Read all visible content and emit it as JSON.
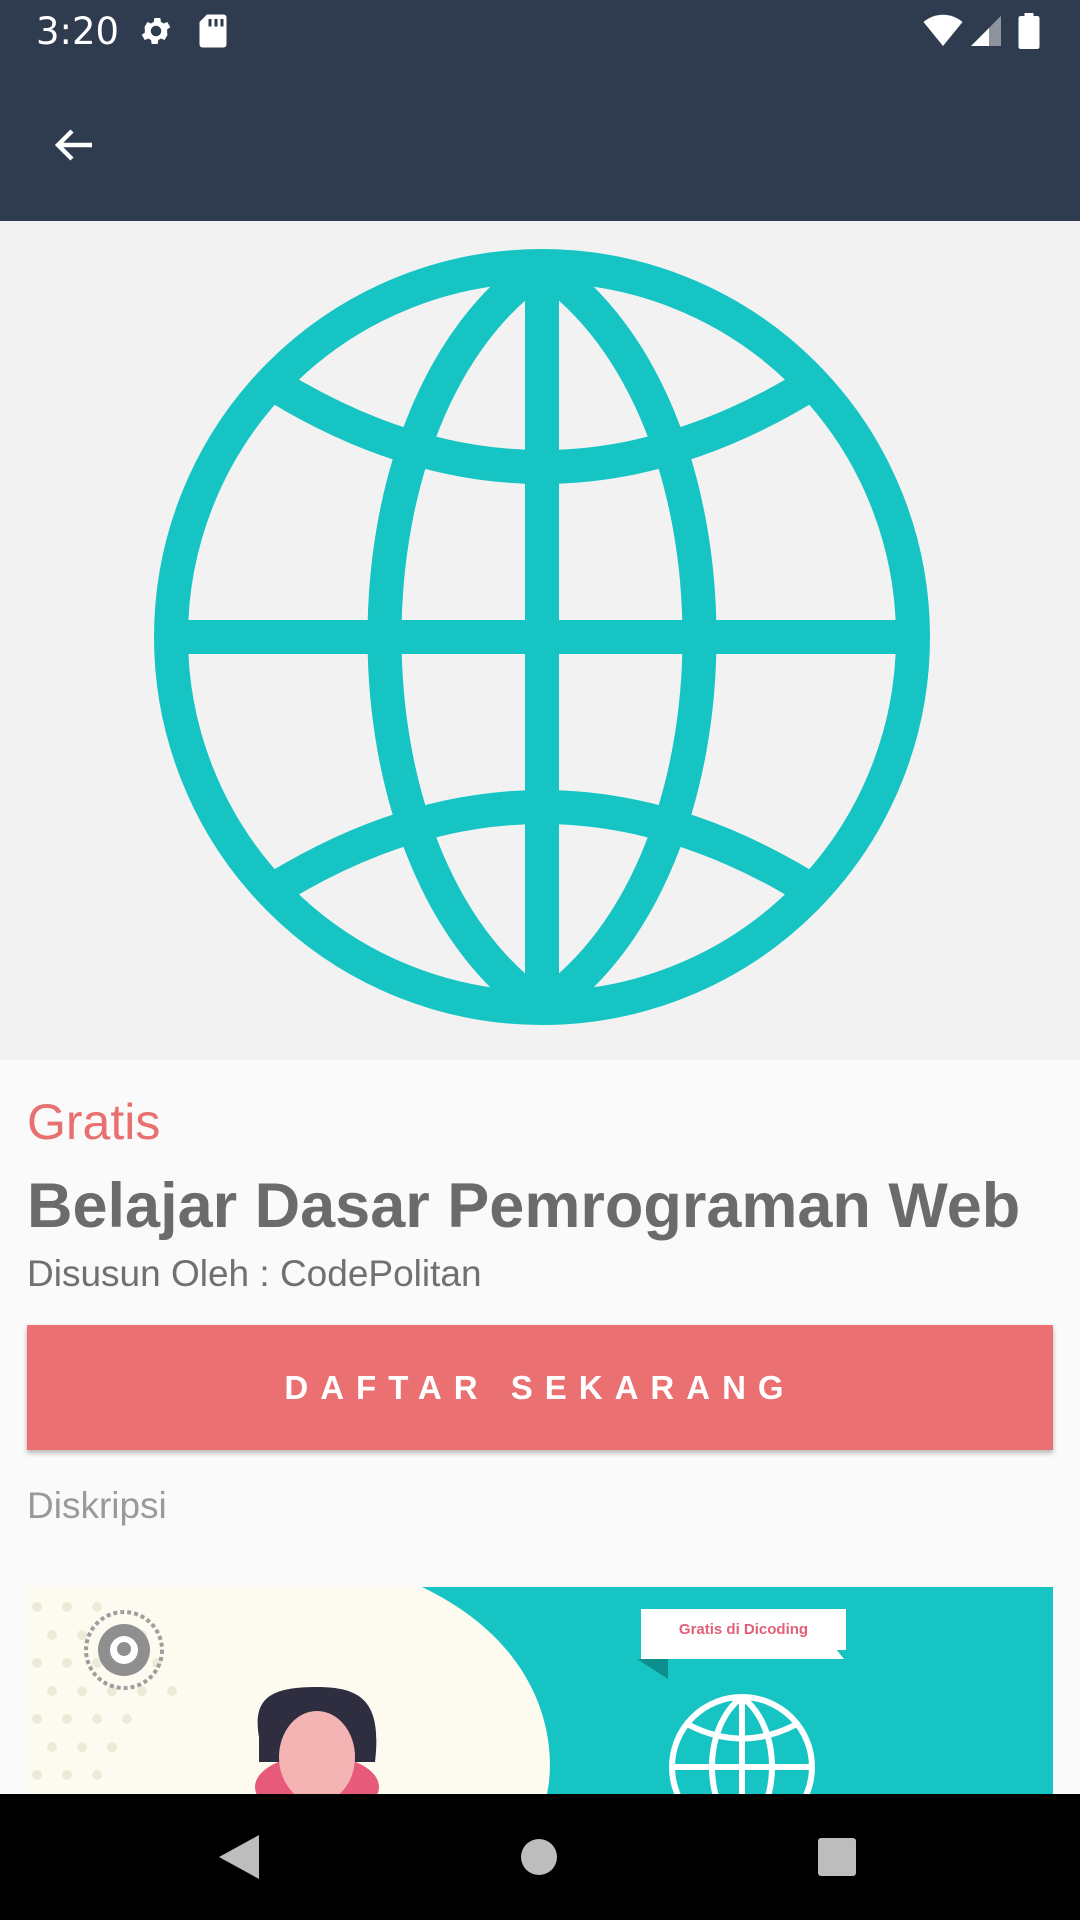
{
  "status_bar": {
    "time": "3:20",
    "icons_left": [
      "gear-icon",
      "sd-card-icon"
    ],
    "icons_right": [
      "wifi-icon",
      "cell-signal-icon",
      "battery-icon"
    ]
  },
  "app_bar": {
    "back_icon": "arrow-left-icon"
  },
  "hero": {
    "icon": "globe-icon",
    "accent_color": "#16c4c4"
  },
  "course": {
    "price": "Gratis",
    "title": "Belajar Dasar Pemrograman Web",
    "author": "Disusun Oleh : CodePolitan"
  },
  "cta": {
    "label": "DAFTAR SEKARANG",
    "color": "#eb7072"
  },
  "description": {
    "label": "Diskripsi"
  },
  "banner": {
    "tag": "Gratis di Dicoding",
    "badge_icon": "dicoding-badge-icon",
    "globe_icon": "globe-icon"
  },
  "nav_bar": {
    "back_icon": "triangle-back-icon",
    "home_icon": "circle-home-icon",
    "recents_icon": "square-recents-icon"
  },
  "colors": {
    "header_bg": "#2f3c4f",
    "price_text": "#e87070",
    "title_text": "#6b6b6b"
  }
}
